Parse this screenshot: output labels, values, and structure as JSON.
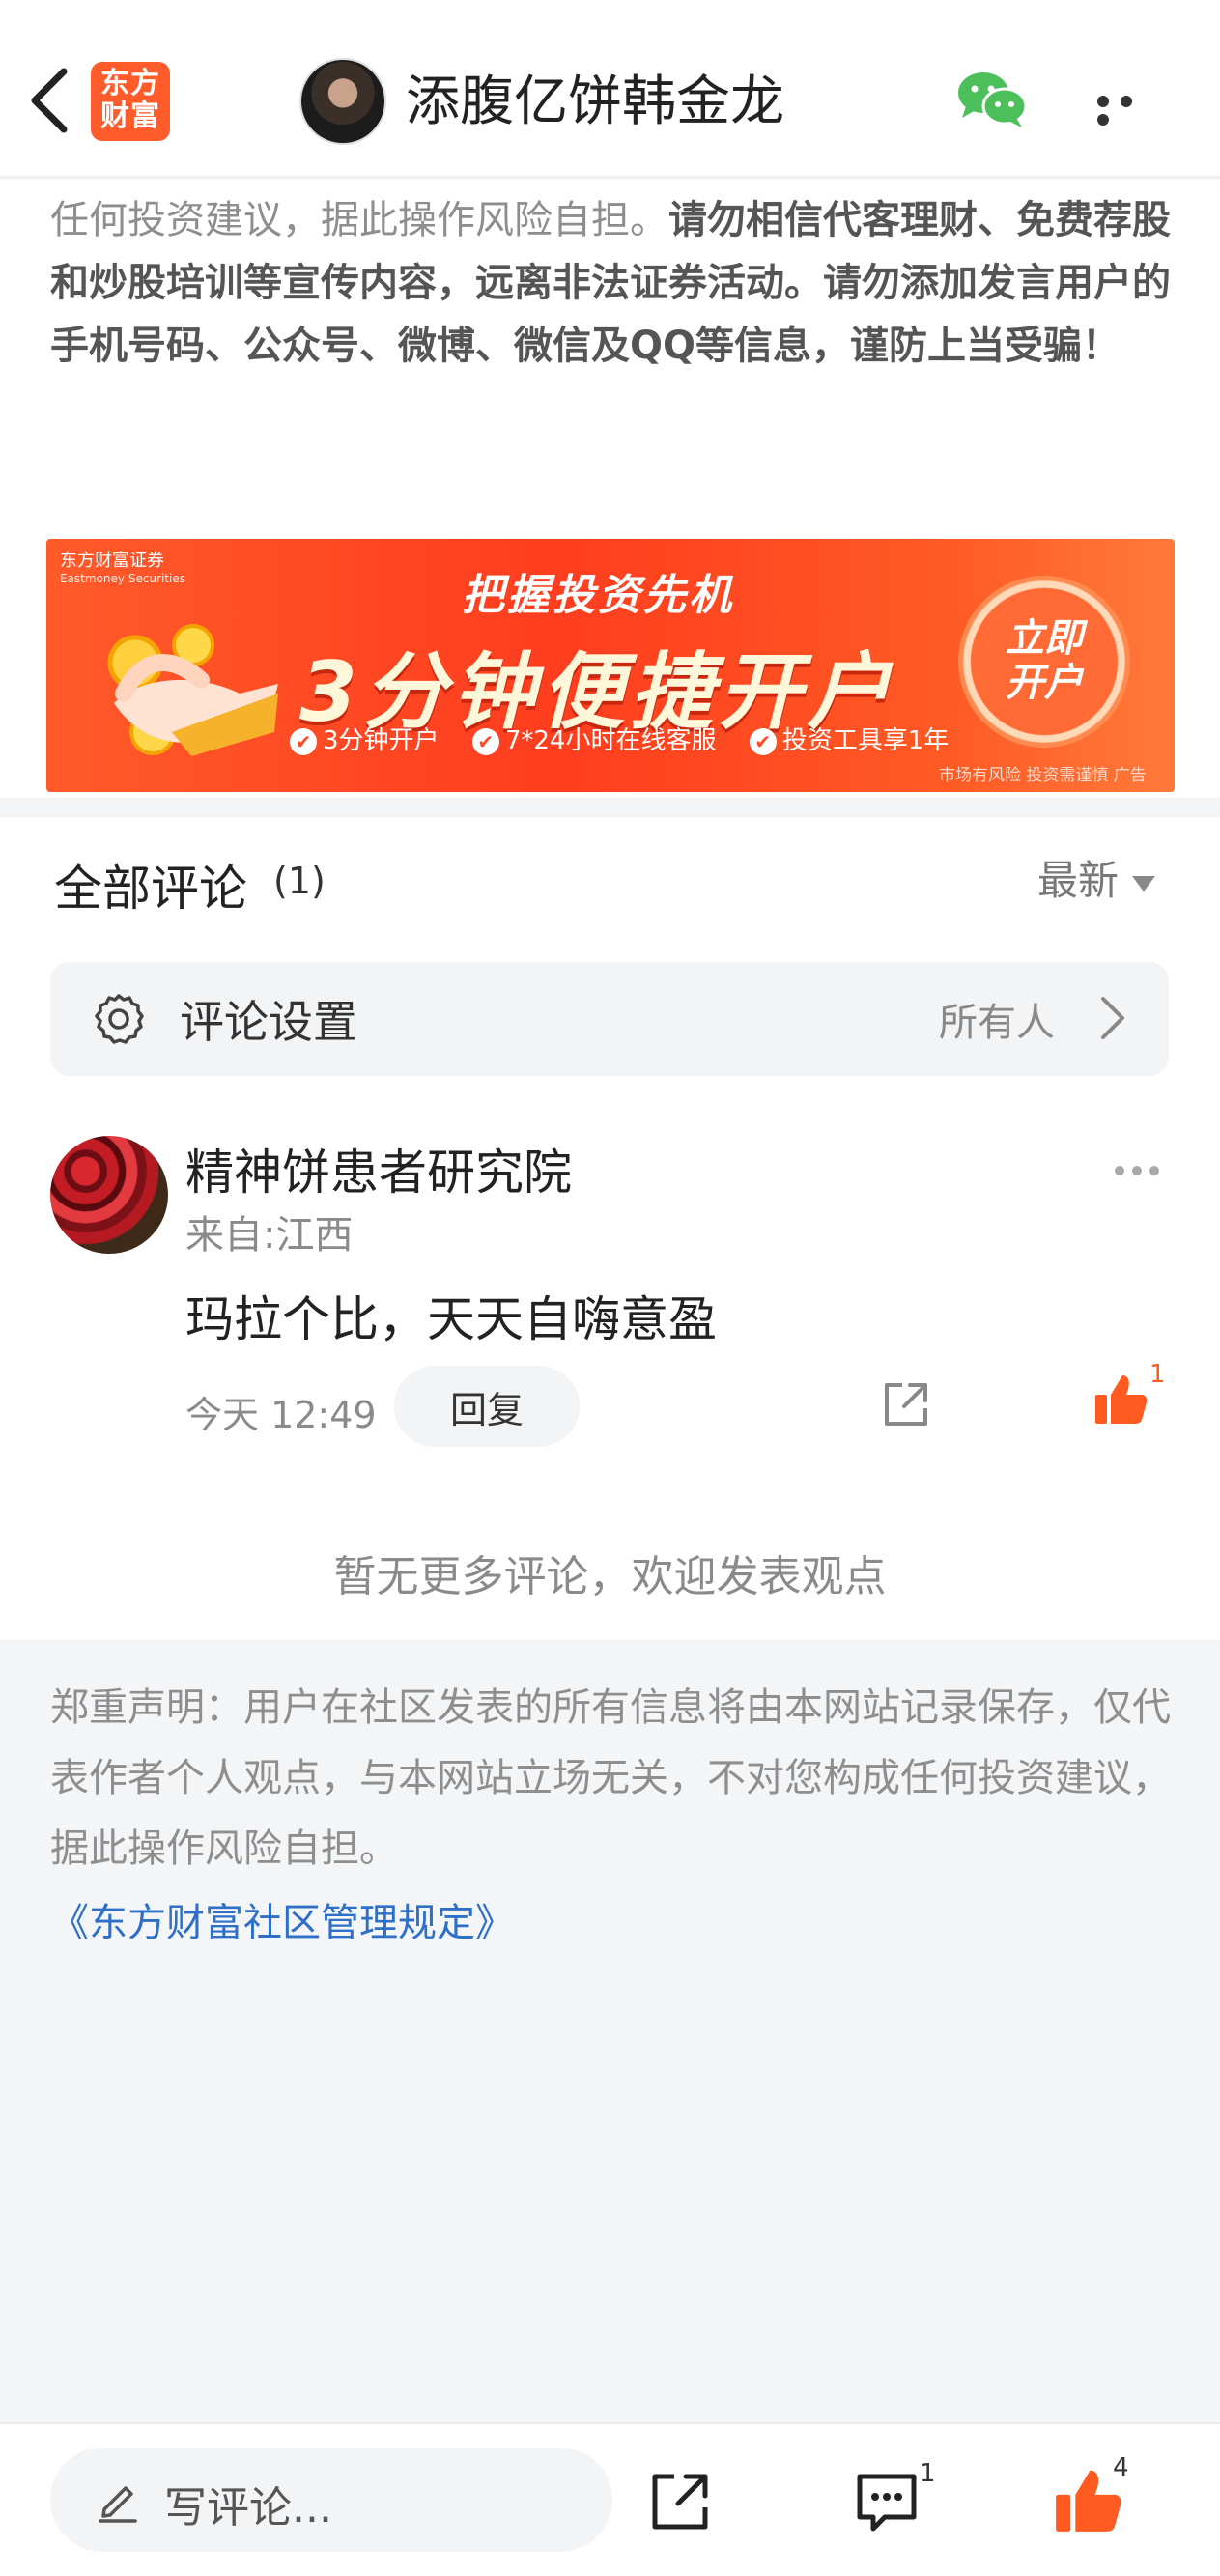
{
  "header": {
    "back_icon": "chevron-left-icon",
    "logo_line1": "东方",
    "logo_line2": "财富",
    "title": "添腹亿饼韩金龙",
    "wechat_icon": "wechat-icon",
    "more_icon": "more-horizontal-icon"
  },
  "notice": {
    "normal": "任何投资建议，据此操作风险自担。",
    "bold": "请勿相信代客理财、免费荐股和炒股培训等宣传内容，远离非法证券活动。请勿添加发言用户的手机号码、公众号、微博、微信及QQ等信息，谨防上当受骗！"
  },
  "ad": {
    "brand": "东方财富证券",
    "brand_en": "Eastmoney Securities",
    "line1": "把握投资先机",
    "line2": "3分钟便捷开户",
    "features": [
      "3分钟开户",
      "7*24小时在线客服",
      "投资工具享1年"
    ],
    "button_line1": "立即",
    "button_line2": "开户",
    "footer": "市场有风险 投资需谨慎 广告"
  },
  "comments": {
    "title": "全部评论",
    "count": "(1)",
    "sort": "最新",
    "settings_label": "评论设置",
    "settings_value": "所有人",
    "items": [
      {
        "author": "精神饼患者研究院",
        "location": "来自:江西",
        "text": "玛拉个比，天天自嗨意盈",
        "time": "今天 12:49",
        "reply_label": "回复",
        "likes": "1"
      }
    ],
    "end_text": "暂无更多评论，欢迎发表观点"
  },
  "disclaimer": {
    "text": "郑重声明：用户在社区发表的所有信息将由本网站记录保存，仅代表作者个人观点，与本网站立场无关，不对您构成任何投资建议，据此操作风险自担。",
    "link": "《东方财富社区管理规定》"
  },
  "bottombar": {
    "write_placeholder": "写评论...",
    "comment_count": "1",
    "like_count": "4"
  },
  "colors": {
    "brand_orange": "#ff5b2b",
    "like_orange": "#ff5a1f",
    "link_blue": "#2e6fc8",
    "wechat_green": "#4cbf5b"
  }
}
